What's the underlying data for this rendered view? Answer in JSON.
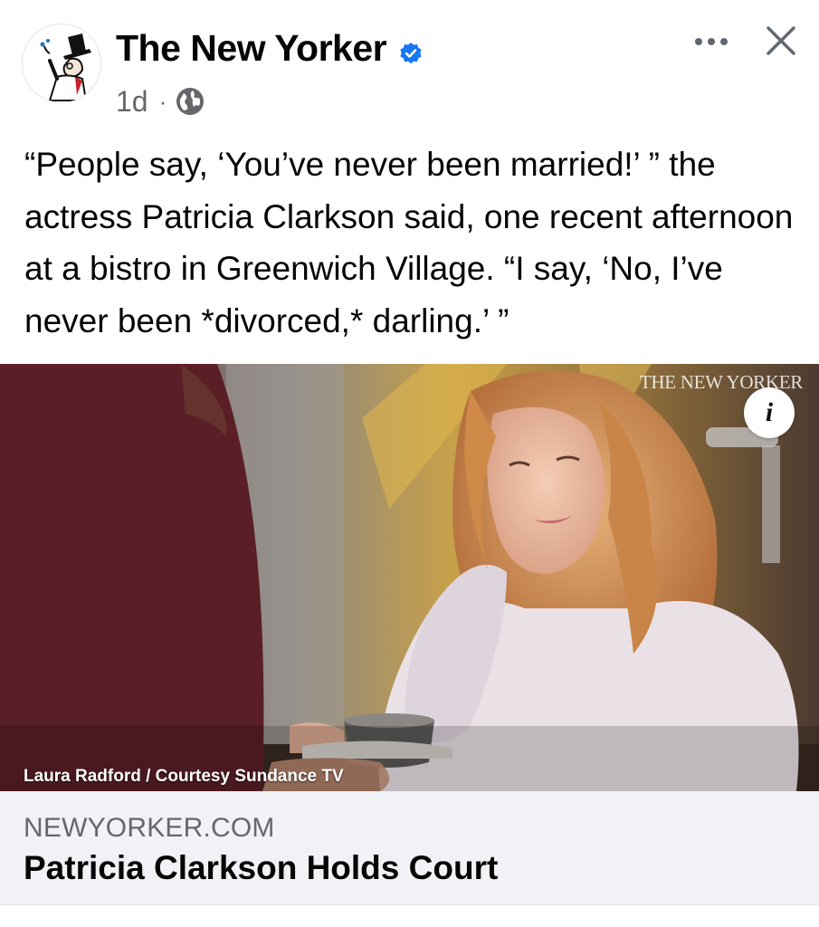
{
  "post": {
    "author": "The New Yorker",
    "verified": true,
    "age": "1d",
    "separator": "·",
    "audience_icon": "globe-icon",
    "text": "“People say, ‘You’ve never been married!’ ” the actress Patricia Clarkson said, one recent afternoon at a bistro in Greenwich Village. “I say, ‘No, I’ve never been *divorced,* darling.’ ”"
  },
  "actions": {
    "more_icon": "more-horizontal-icon",
    "close_icon": "close-icon"
  },
  "media": {
    "watermark": "THE NEW YORKER",
    "info_label": "i",
    "credit": "Laura Radford / Courtesy Sundance TV"
  },
  "link_preview": {
    "domain": "NEWYORKER.COM",
    "title": "Patricia Clarkson Holds Court"
  },
  "colors": {
    "verified_blue": "#1877f2",
    "secondary_text": "#65676b",
    "card_background": "#f0f2f5"
  }
}
